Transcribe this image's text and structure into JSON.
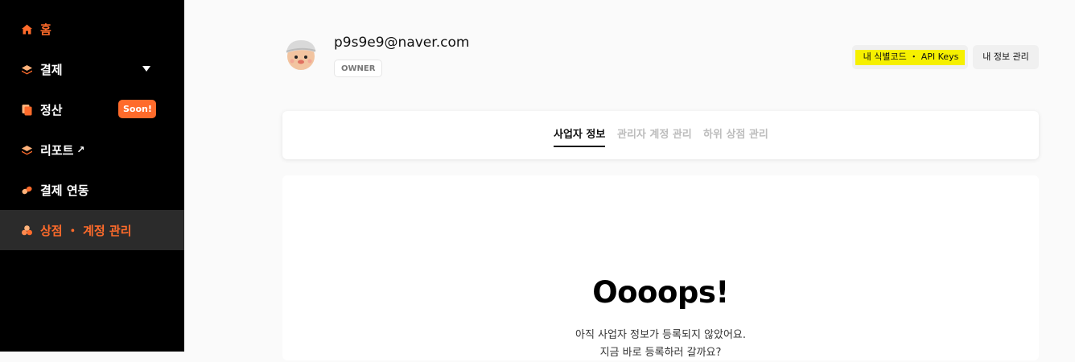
{
  "sidebar": {
    "items": [
      {
        "label": "홈",
        "icon": "home-icon"
      },
      {
        "label": "결제",
        "icon": "layers-icon"
      },
      {
        "label": "정산",
        "icon": "documents-icon",
        "badge": "Soon!"
      },
      {
        "label": "리포트",
        "icon": "layers-icon",
        "suffix": "↗"
      },
      {
        "label": "결제 연동",
        "icon": "pill-icon"
      },
      {
        "label": "상점 ・ 계정 관리",
        "icon": "store-icon"
      }
    ]
  },
  "profile": {
    "email": "p9s9e9@naver.com",
    "role": "OWNER"
  },
  "header_buttons": {
    "api": "내 식별코드 ・ API Keys",
    "info": "내 정보 관리"
  },
  "tabs": [
    "사업자 정보",
    "관리자 계정 관리",
    "하위 상점 관리"
  ],
  "empty_state": {
    "title": "Oooops!",
    "line1": "아직 사업자 정보가 등록되지 않았어요.",
    "line2": "지금 바로 등록하러 갈까요?"
  },
  "colors": {
    "accent": "#ff6b2b",
    "sidebar_bg": "#000000",
    "highlight": "#f6f000"
  }
}
